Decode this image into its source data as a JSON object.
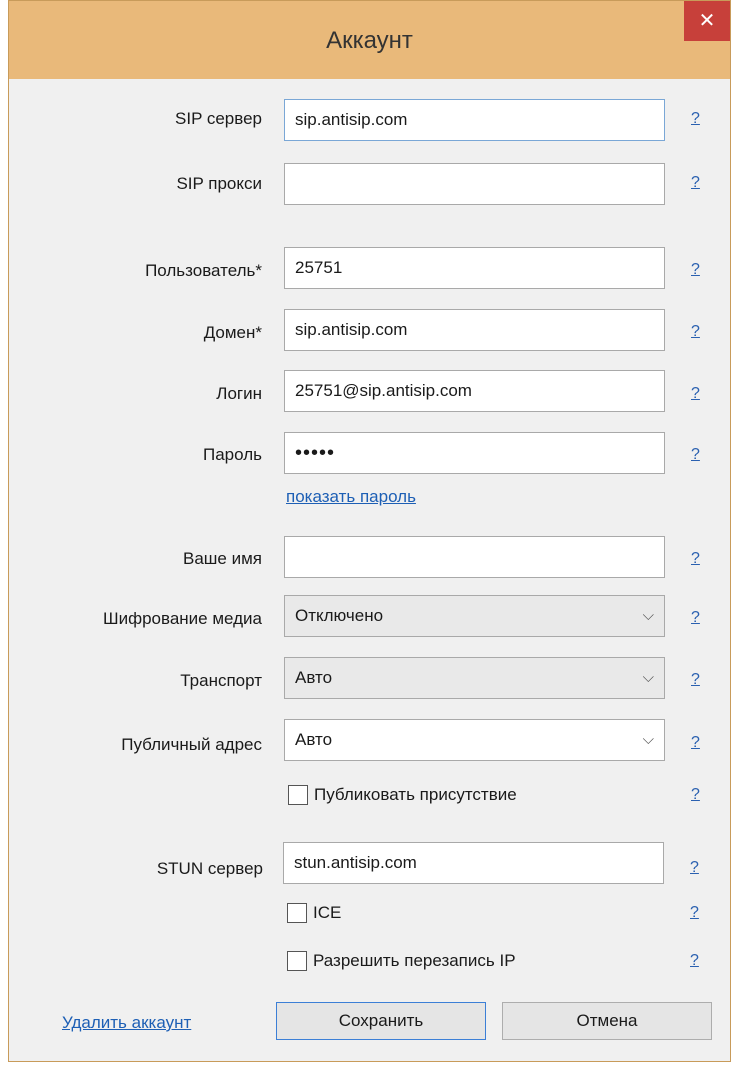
{
  "window": {
    "title": "Аккаунт",
    "close_glyph": "✕"
  },
  "help_glyph": "?",
  "fields": {
    "sip_server": {
      "label": "SIP сервер",
      "value": "sip.antisip.com"
    },
    "sip_proxy": {
      "label": "SIP прокси",
      "value": ""
    },
    "user": {
      "label": "Пользователь*",
      "value": "25751"
    },
    "domain": {
      "label": "Домен*",
      "value": "sip.antisip.com"
    },
    "login": {
      "label": "Логин",
      "value": "25751@sip.antisip.com"
    },
    "password": {
      "label": "Пароль",
      "value": "•••••"
    },
    "show_password": "показать пароль",
    "your_name": {
      "label": "Ваше имя",
      "value": ""
    },
    "media_encryption": {
      "label": "Шифрование медиа",
      "value": "Отключено"
    },
    "transport": {
      "label": "Транспорт",
      "value": "Авто"
    },
    "public_address": {
      "label": "Публичный адрес",
      "value": "Авто"
    },
    "publish_presence": {
      "label": "Публиковать присутствие",
      "checked": false
    },
    "stun_server": {
      "label": "STUN сервер",
      "value": "stun.antisip.com"
    },
    "ice": {
      "label": "ICE",
      "checked": false
    },
    "allow_ip_rewrite": {
      "label": "Разрешить перезапись IP",
      "checked": false
    }
  },
  "footer": {
    "delete_account": "Удалить аккаунт",
    "save": "Сохранить",
    "cancel": "Отмена"
  },
  "colors": {
    "title_bar": "#e9b97a",
    "close_button": "#c7403a",
    "link": "#1d5fb5"
  }
}
